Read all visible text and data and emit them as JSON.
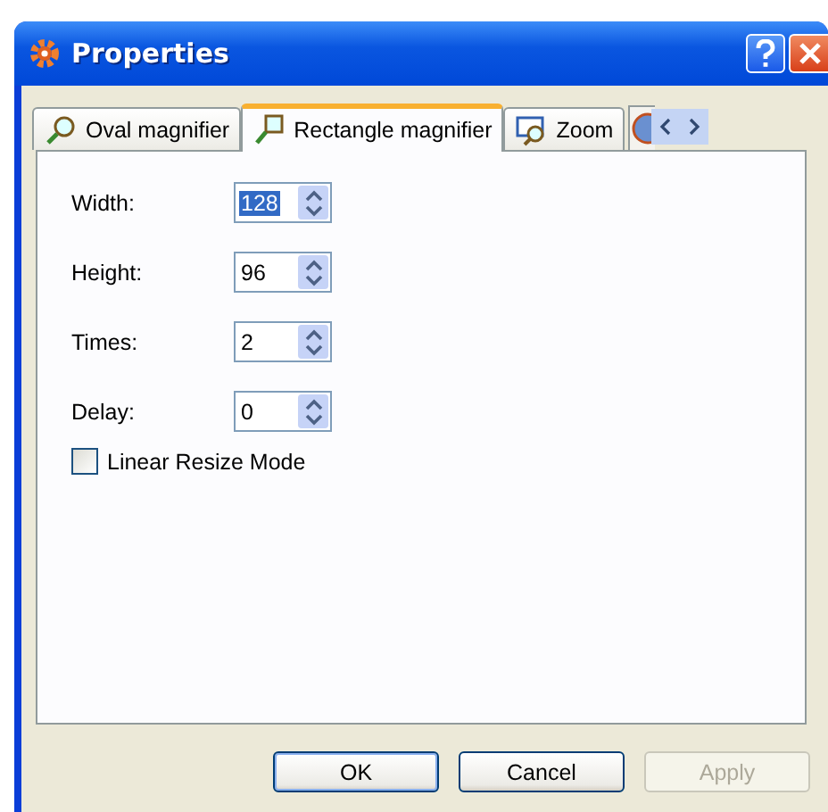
{
  "window": {
    "title": "Properties"
  },
  "tabs": [
    {
      "label": "Oval magnifier",
      "selected": false
    },
    {
      "label": "Rectangle magnifier",
      "selected": true
    },
    {
      "label": "Zoom",
      "selected": false
    }
  ],
  "fields": [
    {
      "label": "Width:",
      "value": "128",
      "text_selected": true
    },
    {
      "label": "Height:",
      "value": "96",
      "text_selected": false
    },
    {
      "label": "Times:",
      "value": "2",
      "text_selected": false
    },
    {
      "label": "Delay:",
      "value": "0",
      "text_selected": false
    }
  ],
  "checkbox": {
    "label": "Linear Resize Mode",
    "checked": false
  },
  "buttons": [
    {
      "label": "OK",
      "disabled": false
    },
    {
      "label": "Cancel",
      "disabled": false
    },
    {
      "label": "Apply",
      "disabled": true
    }
  ]
}
